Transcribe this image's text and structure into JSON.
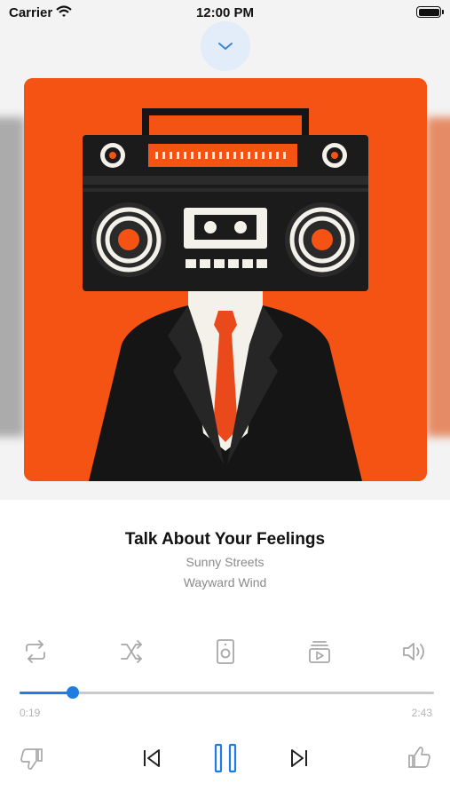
{
  "status_bar": {
    "carrier": "Carrier",
    "time": "12:00 PM"
  },
  "track": {
    "title": "Talk About Your Feelings",
    "artist": "Sunny Streets",
    "album": "Wayward Wind"
  },
  "progress": {
    "elapsed": "0:19",
    "duration": "2:43",
    "fraction": 0.128
  },
  "colors": {
    "accent": "#1f7de0",
    "cover_bg": "#f45314",
    "icon_gray": "#a8a8a8"
  },
  "icons": {
    "collapse": "chevron-down-icon",
    "repeat": "repeat-icon",
    "shuffle": "shuffle-icon",
    "speaker": "speaker-device-icon",
    "video": "video-queue-icon",
    "volume": "volume-icon",
    "dislike": "thumbs-down-icon",
    "previous": "skip-back-icon",
    "pause": "pause-icon",
    "next": "skip-forward-icon",
    "like": "thumbs-up-icon"
  }
}
